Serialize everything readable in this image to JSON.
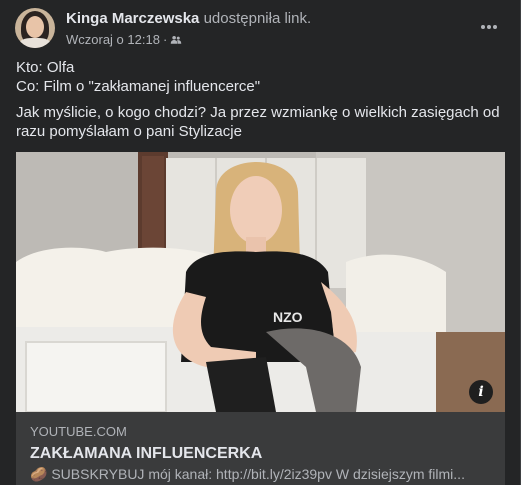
{
  "post": {
    "author_name": "Kinga Marczewska",
    "action_text": "udostępniła link.",
    "timestamp": "Wczoraj o 12:18",
    "separator": "·",
    "privacy_icon": "friends-icon",
    "more_icon": "more-horizontal-icon",
    "text_lines": [
      "Kto: Olfa",
      "Co: Film o \"zakłamanej influencerce\"",
      "Jak myślicie, o kogo chodzi? Ja przez wzmiankę o wielkich zasięgach od razu pomyślałam o pani Stylizacje"
    ]
  },
  "link_preview": {
    "domain": "YOUTUBE.COM",
    "title": "ZAKŁAMANA INFLUENCERKA",
    "description": "🥔 SUBSKRYBUJ mój kanał: http://bit.ly/2iz39pv W dzisiejszym filmi...",
    "info_icon": "info-icon",
    "info_label": "i"
  },
  "colors": {
    "card_bg": "#242526",
    "text_primary": "#e4e6eb",
    "text_secondary": "#b0b3b8",
    "link_bg": "#3a3b3c"
  }
}
